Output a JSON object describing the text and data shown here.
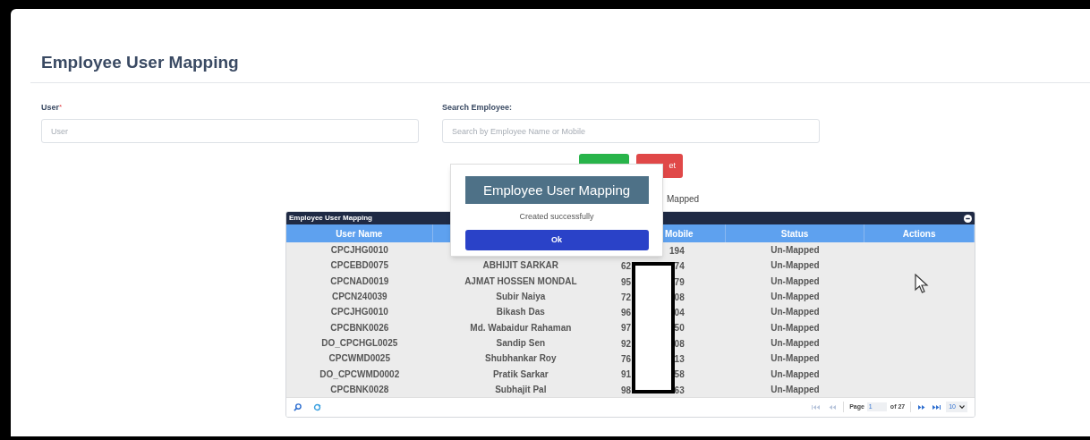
{
  "page": {
    "title": "Employee User Mapping"
  },
  "form": {
    "fields": [
      {
        "label": "User",
        "required_mark": "*",
        "placeholder": "User"
      },
      {
        "label": "Search Employee:",
        "placeholder": "Search by Employee Name or Mobile"
      }
    ],
    "buttons": [
      {
        "kind": "submit"
      },
      {
        "kind": "reset",
        "label": "et"
      }
    ],
    "filter_label": "Mapped"
  },
  "grid": {
    "caption": "Employee User Mapping",
    "columns": [
      "User Name",
      "",
      "Mobile",
      "Status",
      "Actions"
    ],
    "rows": [
      {
        "user_name": "CPCJHG0010",
        "mobile_end": "194",
        "status": "Un-Mapped"
      },
      {
        "user_name": "CPCEBD0075",
        "name": "ABHIJIT SARKAR",
        "mobile_start": "62",
        "mobile_end": "74",
        "status": "Un-Mapped"
      },
      {
        "user_name": "CPCNAD0019",
        "name": "AJMAT HOSSEN MONDAL",
        "mobile_start": "95",
        "mobile_end": "79",
        "status": "Un-Mapped"
      },
      {
        "user_name": "CPCN240039",
        "name": "Subir Naiya",
        "mobile_start": "72",
        "mobile_end": "08",
        "status": "Un-Mapped"
      },
      {
        "user_name": "CPCJHG0010",
        "name": "Bikash Das",
        "mobile_start": "96",
        "mobile_end": "04",
        "status": "Un-Mapped"
      },
      {
        "user_name": "CPCBNK0026",
        "name": "Md. Wabaidur Rahaman",
        "mobile_start": "97",
        "mobile_end": "50",
        "status": "Un-Mapped"
      },
      {
        "user_name": "DO_CPCHGL0025",
        "name": "Sandip Sen",
        "mobile_start": "92",
        "mobile_end": "08",
        "status": "Un-Mapped"
      },
      {
        "user_name": "CPCWMD0025",
        "name": "Shubhankar Roy",
        "mobile_start": "76",
        "mobile_end": "13",
        "status": "Un-Mapped"
      },
      {
        "user_name": "DO_CPCWMD0002",
        "name": "Pratik Sarkar",
        "mobile_start": "91",
        "mobile_end": "58",
        "status": "Un-Mapped"
      },
      {
        "user_name": "CPCBNK0028",
        "name": "Subhajit Pal",
        "mobile_start": "98",
        "mobile_end": "63",
        "status": "Un-Mapped"
      }
    ],
    "pager": {
      "page_label": "Page",
      "page": "1",
      "of_label": "of 27",
      "page_size": "10"
    }
  },
  "dialog": {
    "title": "Employee User Mapping",
    "message": "Created successfully",
    "button": "Ok"
  }
}
